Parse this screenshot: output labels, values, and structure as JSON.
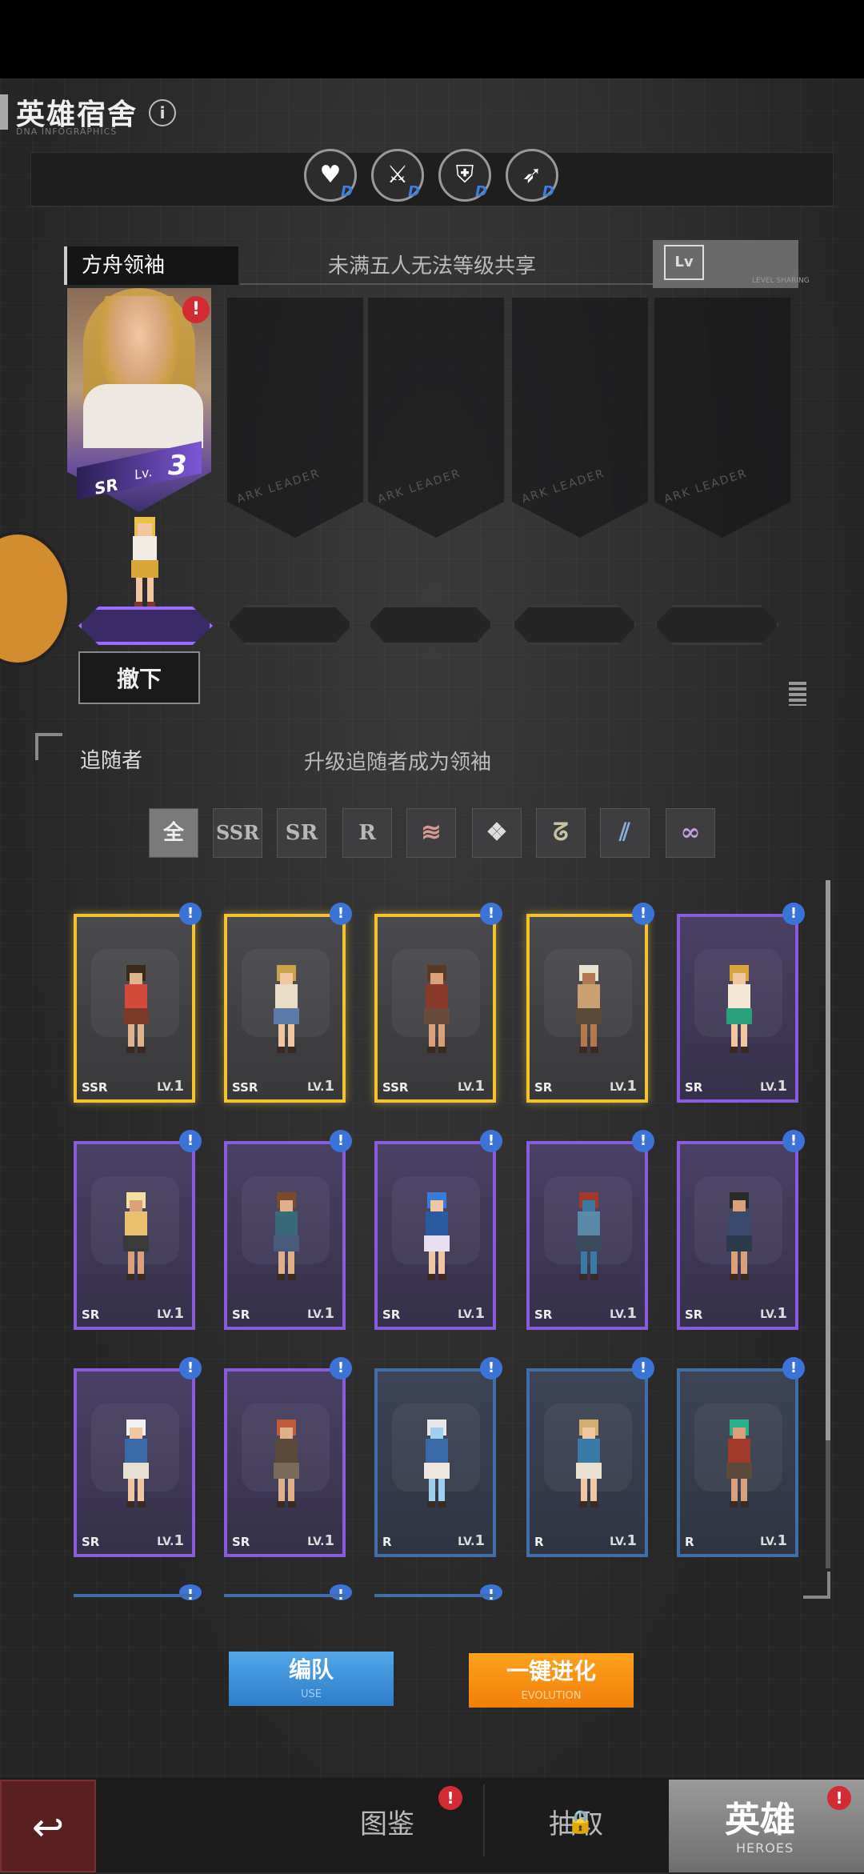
{
  "header": {
    "title": "英雄宿舍",
    "subtitle": "DNA INFOGRAPHICS",
    "info_icon": "info-icon"
  },
  "attributes": [
    {
      "icon": "heart-pulse-icon",
      "grade": "D"
    },
    {
      "icon": "sword-icon",
      "grade": "D"
    },
    {
      "icon": "shield-icon",
      "grade": "D"
    },
    {
      "icon": "bow-icon",
      "grade": "D"
    }
  ],
  "team": {
    "leader_tab": "方舟领袖",
    "share_text": "未满五人无法等级共享",
    "lv_icon_label": "Lv",
    "lv_sub": "LEVEL SHARING",
    "slot_label": "ARK LEADER",
    "leader": {
      "rarity": "SR",
      "level_prefix": "Lv.",
      "level": "3",
      "alert": "!"
    },
    "remove_button": "撤下"
  },
  "followers": {
    "label": "追随者",
    "tip": "升级追随者成为领袖",
    "filters": [
      {
        "label": "全",
        "active": true
      },
      {
        "label": "SSR",
        "active": false
      },
      {
        "label": "SR",
        "active": false
      },
      {
        "label": "R",
        "active": false
      },
      {
        "label": "faction-1-icon",
        "active": false
      },
      {
        "label": "faction-2-icon",
        "active": false
      },
      {
        "label": "faction-3-icon",
        "active": false
      },
      {
        "label": "faction-4-icon",
        "active": false
      },
      {
        "label": "faction-5-icon",
        "active": false
      }
    ],
    "cards": [
      {
        "rarity": "SSR",
        "lv": "LV.",
        "level": "1"
      },
      {
        "rarity": "SSR",
        "lv": "LV.",
        "level": "1"
      },
      {
        "rarity": "SSR",
        "lv": "LV.",
        "level": "1"
      },
      {
        "rarity": "SR",
        "lv": "LV.",
        "level": "1"
      },
      {
        "rarity": "SR",
        "lv": "LV.",
        "level": "1"
      },
      {
        "rarity": "SR",
        "lv": "LV.",
        "level": "1"
      },
      {
        "rarity": "SR",
        "lv": "LV.",
        "level": "1"
      },
      {
        "rarity": "SR",
        "lv": "LV.",
        "level": "1"
      },
      {
        "rarity": "SR",
        "lv": "LV.",
        "level": "1"
      },
      {
        "rarity": "SR",
        "lv": "LV.",
        "level": "1"
      },
      {
        "rarity": "SR",
        "lv": "LV.",
        "level": "1"
      },
      {
        "rarity": "SR",
        "lv": "LV.",
        "level": "1"
      },
      {
        "rarity": "R",
        "lv": "LV.",
        "level": "1"
      },
      {
        "rarity": "R",
        "lv": "LV.",
        "level": "1"
      },
      {
        "rarity": "R",
        "lv": "LV.",
        "level": "1"
      }
    ],
    "card_alert": "!"
  },
  "actions": {
    "form_label": "编队",
    "form_sub": "USE",
    "evolve_label": "一键进化",
    "evolve_sub": "EVOLUTION"
  },
  "nav": {
    "back_icon": "back-arrow-icon",
    "codex": "图鉴",
    "recruit": "抽取",
    "heroes": "英雄",
    "heroes_sub": "HEROES",
    "alert": "!"
  },
  "colors": {
    "ssr": "#f2c230",
    "sr": "#8a5bdc",
    "r": "#3f6ea8",
    "alert_red": "#d42b33",
    "alert_blue": "#3a74d8",
    "form_button": "#3a8ad6",
    "evolve_button": "#f7900f"
  }
}
